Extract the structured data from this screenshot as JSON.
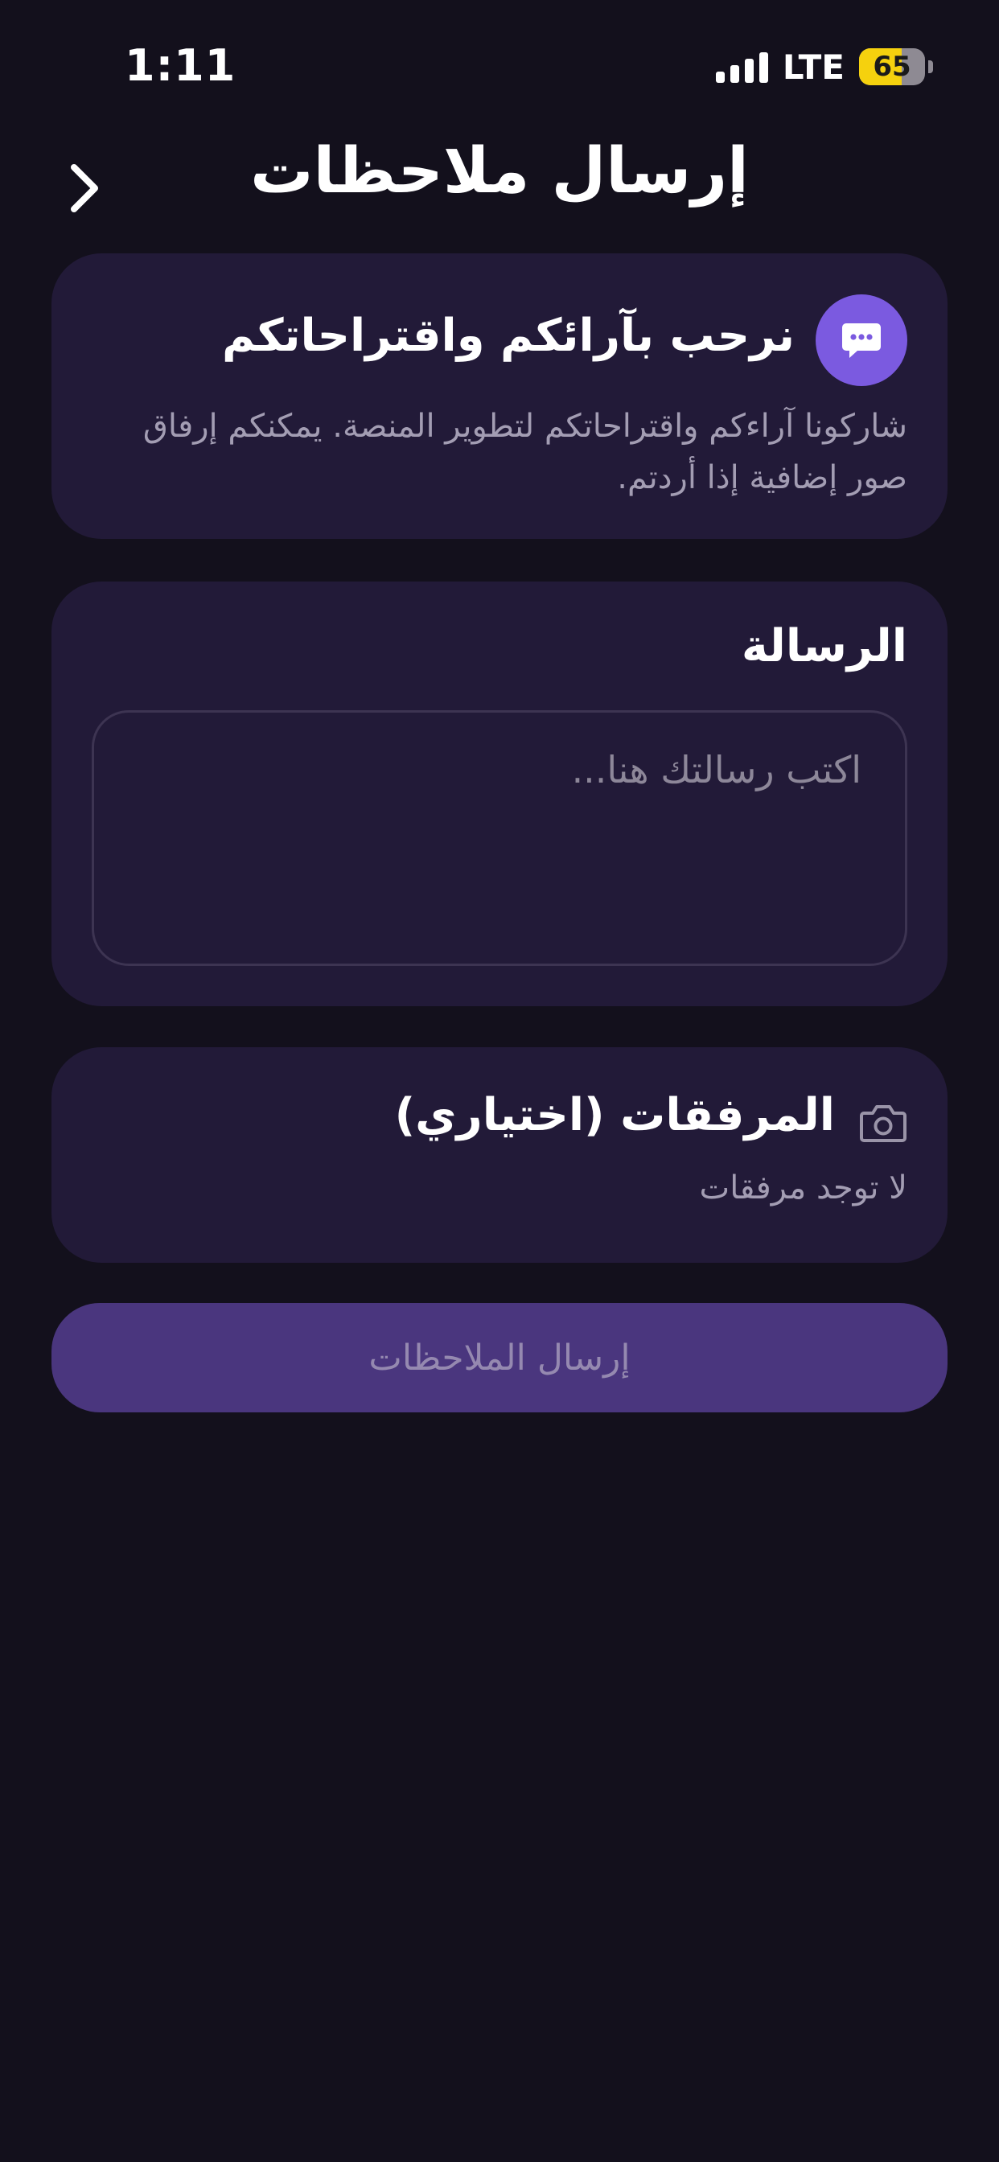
{
  "status_bar": {
    "time": "1:11",
    "network": "LTE",
    "battery_percent": "65",
    "battery_level": 0.65
  },
  "header": {
    "title": "إرسال ملاحظات",
    "back_icon": "chevron-right-icon"
  },
  "welcome_card": {
    "icon": "chat-bubble-icon",
    "title": "نرحب بآرائكم واقتراحاتكم",
    "description": "شاركونا آراءكم واقتراحاتكم لتطوير المنصة. يمكنكم إرفاق صور إضافية إذا أردتم."
  },
  "message_card": {
    "title": "الرسالة",
    "input_value": "",
    "input_placeholder": "اكتب رسالتك هنا..."
  },
  "attachments_card": {
    "icon": "camera-icon",
    "title": "المرفقات (اختياري)",
    "empty_text": "لا توجد مرفقات"
  },
  "submit": {
    "label": "إرسال الملاحظات"
  },
  "colors": {
    "background": "#13101c",
    "card": "#221a38",
    "accent": "#7b5ae0",
    "button_disabled": "#4a367e",
    "battery": "#f5d10e"
  }
}
